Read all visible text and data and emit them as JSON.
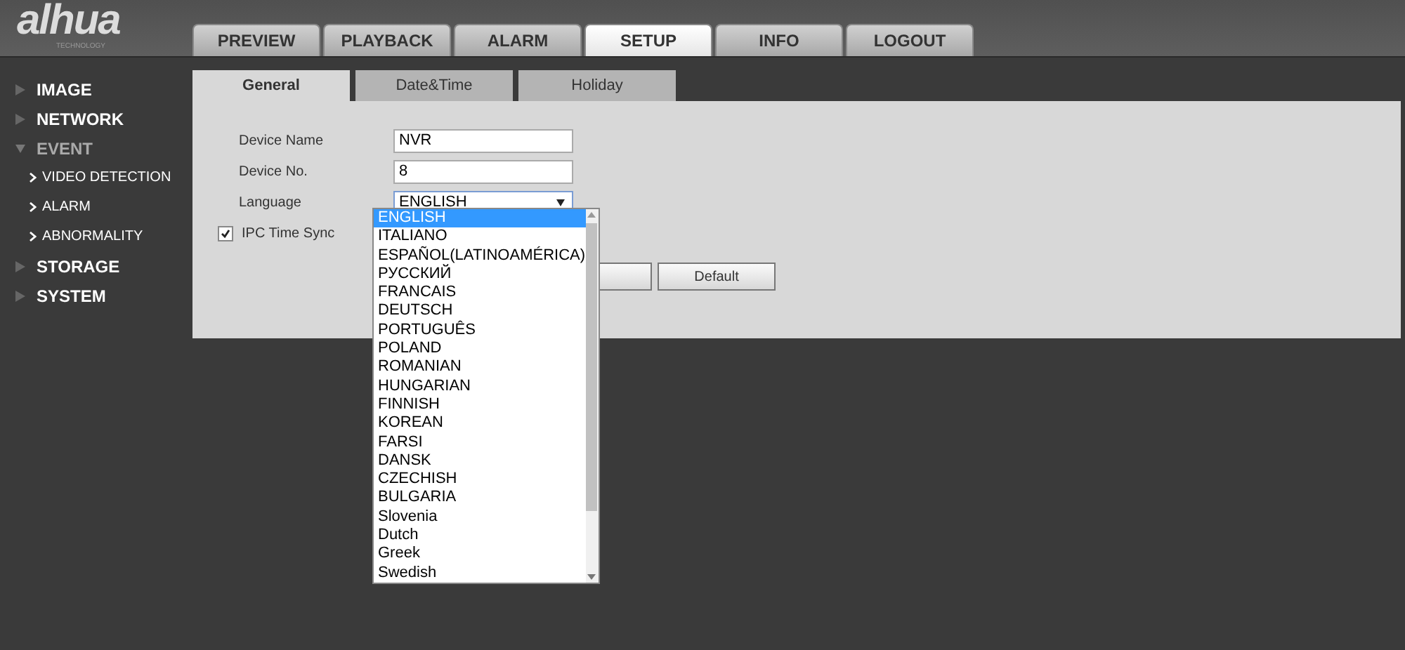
{
  "logo": {
    "name": "alhua",
    "tagline": "TECHNOLOGY"
  },
  "main_tabs": [
    {
      "label": "PREVIEW",
      "selected": false
    },
    {
      "label": "PLAYBACK",
      "selected": false
    },
    {
      "label": "ALARM",
      "selected": false
    },
    {
      "label": "SETUP",
      "selected": true
    },
    {
      "label": "INFO",
      "selected": false
    },
    {
      "label": "LOGOUT",
      "selected": false
    }
  ],
  "sidebar": {
    "items": [
      {
        "label": "IMAGE",
        "expanded": false
      },
      {
        "label": "NETWORK",
        "expanded": false
      },
      {
        "label": "EVENT",
        "expanded": true,
        "children": [
          {
            "label": "VIDEO DETECTION"
          },
          {
            "label": "ALARM"
          },
          {
            "label": "ABNORMALITY"
          }
        ]
      },
      {
        "label": "STORAGE",
        "expanded": false
      },
      {
        "label": "SYSTEM",
        "expanded": false
      }
    ]
  },
  "sub_tabs": [
    {
      "label": "General",
      "selected": true
    },
    {
      "label": "Date&Time",
      "selected": false
    },
    {
      "label": "Holiday",
      "selected": false
    }
  ],
  "form": {
    "device_name": {
      "label": "Device Name",
      "value": "NVR"
    },
    "device_no": {
      "label": "Device No.",
      "value": "8"
    },
    "language": {
      "label": "Language",
      "value": "ENGLISH",
      "expanded": true
    },
    "ipc_time_sync": {
      "label": "IPC Time Sync",
      "checked": true
    },
    "buttons": [
      "Default"
    ]
  },
  "language_options": [
    {
      "label": "ENGLISH",
      "selected": true
    },
    {
      "label": "ITALIANO",
      "selected": false
    },
    {
      "label": "ESPAÑOL(LATINOAMÉRICA)",
      "selected": false
    },
    {
      "label": "РУССКИЙ",
      "selected": false
    },
    {
      "label": "FRANCAIS",
      "selected": false
    },
    {
      "label": "DEUTSCH",
      "selected": false
    },
    {
      "label": "PORTUGUÊS",
      "selected": false
    },
    {
      "label": "POLAND",
      "selected": false
    },
    {
      "label": "ROMANIAN",
      "selected": false
    },
    {
      "label": "HUNGARIAN",
      "selected": false
    },
    {
      "label": "FINNISH",
      "selected": false
    },
    {
      "label": "KOREAN",
      "selected": false
    },
    {
      "label": "FARSI",
      "selected": false
    },
    {
      "label": "DANSK",
      "selected": false
    },
    {
      "label": "CZECHISH",
      "selected": false
    },
    {
      "label": "BULGARIA",
      "selected": false
    },
    {
      "label": "Slovenia",
      "selected": false
    },
    {
      "label": "Dutch",
      "selected": false
    },
    {
      "label": "Greek",
      "selected": false
    },
    {
      "label": "Swedish",
      "selected": false
    }
  ]
}
